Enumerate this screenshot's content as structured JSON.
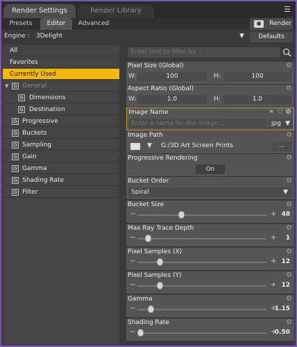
{
  "tabs": {
    "render_settings": "Render Settings",
    "render_library": "Render Library"
  },
  "subtabs": {
    "presets": "Presets",
    "editor": "Editor",
    "advanced": "Advanced"
  },
  "render_button": "Render",
  "engine": {
    "label": "Engine :",
    "value": "3Delight",
    "defaults": "Defaults"
  },
  "sidebar": {
    "items": [
      {
        "label": "All"
      },
      {
        "label": "Favorites"
      },
      {
        "label": "Currently Used"
      },
      {
        "label": "General"
      },
      {
        "label": "Dimensions"
      },
      {
        "label": "Destination"
      },
      {
        "label": "Progressive"
      },
      {
        "label": "Buckets"
      },
      {
        "label": "Sampling"
      },
      {
        "label": "Gain"
      },
      {
        "label": "Gamma"
      },
      {
        "label": "Shading Rate"
      },
      {
        "label": "Filter"
      }
    ],
    "selected": "Currently Used",
    "group_icon": "G"
  },
  "filter": {
    "placeholder": "Enter text to filter by..."
  },
  "props": {
    "pixel_size": {
      "title": "Pixel Size (Global)",
      "w_label": "W:",
      "w": "100",
      "h_label": "H:",
      "h": "100"
    },
    "aspect_ratio": {
      "title": "Aspect Ratio (Global)",
      "w_label": "W:",
      "w": "1.0",
      "h_label": "H:",
      "h": "1.0"
    },
    "image_name": {
      "title": "Image Name",
      "placeholder": "Enter a name for the image...",
      "ext": "jpg"
    },
    "image_path": {
      "title": "Image Path",
      "value": "G:/3D Art Screen Prints",
      "browse": "..."
    },
    "progressive": {
      "title": "Progressive Rendering",
      "value": "On"
    },
    "bucket_order": {
      "title": "Bucket Order",
      "value": "Spiral"
    },
    "bucket_size": {
      "title": "Bucket Size",
      "value": "48",
      "level": 0.34
    },
    "max_ray_depth": {
      "title": "Max Ray Trace Depth",
      "value": "1",
      "level": 0.08
    },
    "pixel_samples_x": {
      "title": "Pixel Samples (X)",
      "value": "12",
      "level": 0.17
    },
    "pixel_samples_y": {
      "title": "Pixel Samples (Y)",
      "value": "12",
      "level": 0.17
    },
    "gamma": {
      "title": "Gamma",
      "value": "1.15",
      "level": 0.1
    },
    "shading_rate": {
      "title": "Shading Rate",
      "value": "0.50",
      "level": 0.02
    }
  },
  "colors": {
    "selected": "#f4b70a",
    "border": "#7c57b1"
  }
}
